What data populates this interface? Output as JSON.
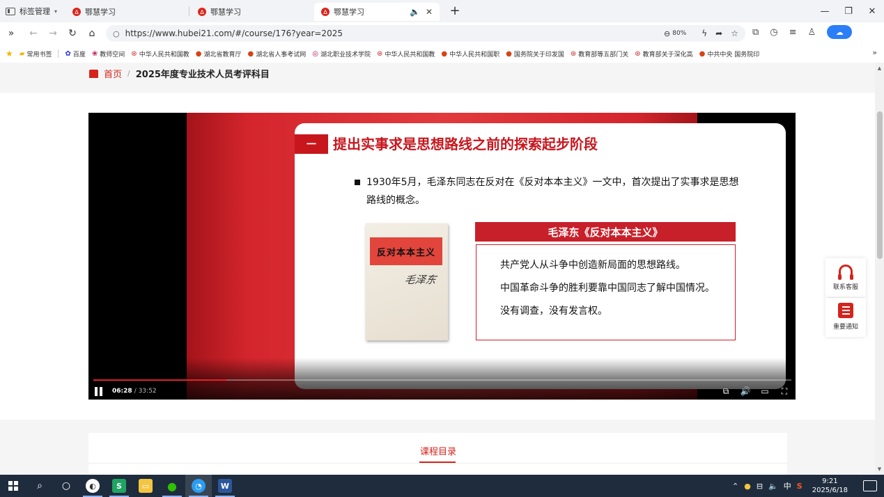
{
  "browser": {
    "tab_manager_label": "标签管理",
    "tabs": [
      {
        "title": "鄂慧学习"
      },
      {
        "title": "鄂慧学习"
      },
      {
        "title": "鄂慧学习"
      }
    ],
    "url": "https://www.hubei21.com/#/course/176?year=2025",
    "zoom": "80%",
    "bookmarks": [
      {
        "label": "常用书签",
        "icon": "folder-icon"
      },
      {
        "label": "百度",
        "icon": "baidu-icon"
      },
      {
        "label": "教师空间",
        "icon": "flower-icon"
      },
      {
        "label": "中华人民共和国教",
        "icon": "emblem-icon"
      },
      {
        "label": "湖北省教育厅",
        "icon": "gov-icon"
      },
      {
        "label": "湖北省人事考试网",
        "icon": "gov-icon"
      },
      {
        "label": "湖北职业技术学院",
        "icon": "school-icon"
      },
      {
        "label": "中华人民共和国教",
        "icon": "emblem-icon"
      },
      {
        "label": "中华人民共和国职",
        "icon": "gov-icon"
      },
      {
        "label": "国务院关于印发国",
        "icon": "gov-icon"
      },
      {
        "label": "教育部等五部门关",
        "icon": "emblem-icon"
      },
      {
        "label": "教育部关于深化高",
        "icon": "emblem-icon"
      },
      {
        "label": "中共中央 国务院印",
        "icon": "gov-icon"
      }
    ]
  },
  "page": {
    "breadcrumb": {
      "home": "首页",
      "separator": "/",
      "current": "2025年度专业技术人员考评科目"
    },
    "catalog_tab": "课程目录",
    "side_widgets": {
      "service": "联系客服",
      "notice": "重要通知"
    }
  },
  "video": {
    "current_time": "06:28",
    "duration": "33:52",
    "progress": 0.191,
    "slide": {
      "number": "一",
      "title": "提出实事求是思想路线之前的探索起步阶段",
      "bullet": "1930年5月，毛泽东同志在反对在《反对本本主义》一文中，首次提出了实事求是思想路线的概念。",
      "book_title": "反对本本主义",
      "book_signature": "毛泽东",
      "quote_heading": "毛泽东《反对本本主义》",
      "quotes": [
        "共产党人从斗争中创造新局面的思想路线。",
        "中国革命斗争的胜利要靠中国同志了解中国情况。",
        "没有调查，没有发言权。"
      ]
    }
  },
  "taskbar": {
    "time": "9:21",
    "date": "2025/6/18",
    "ime": "中"
  }
}
